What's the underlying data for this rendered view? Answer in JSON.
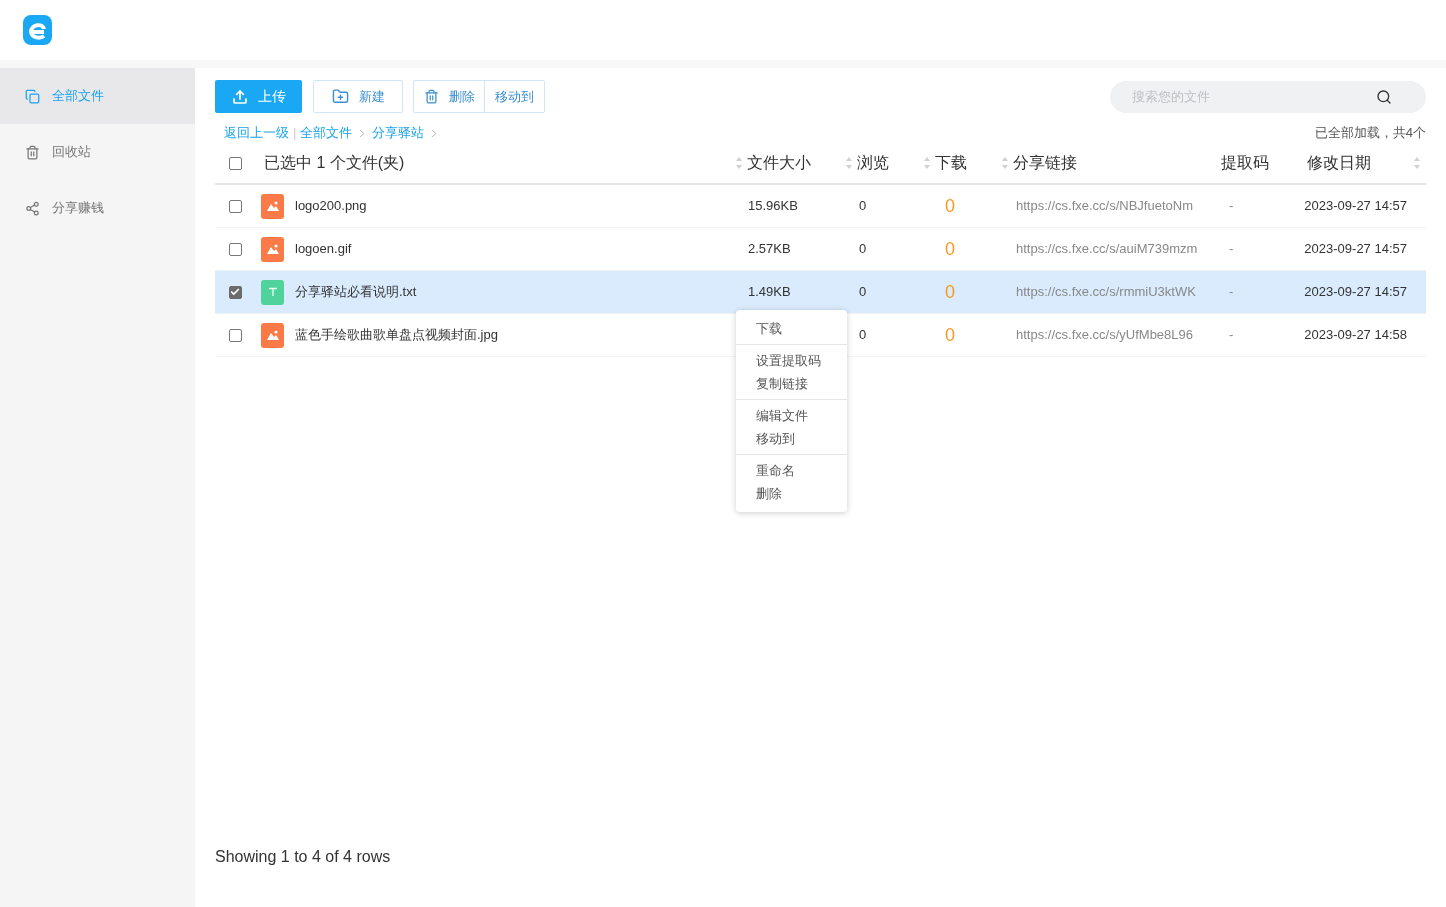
{
  "sidebar": {
    "items": [
      {
        "label": "全部文件",
        "selected": true
      },
      {
        "label": "回收站",
        "selected": false
      },
      {
        "label": "分享赚钱",
        "selected": false
      }
    ]
  },
  "toolbar": {
    "upload": "上传",
    "new": "新建",
    "delete": "删除",
    "move": "移动到"
  },
  "search": {
    "placeholder": "搜索您的文件"
  },
  "breadcrumb": {
    "back": "返回上一级",
    "separator": "|",
    "items": [
      "全部文件",
      "分享驿站"
    ]
  },
  "load_status": "已全部加载，共4个",
  "table": {
    "select_all_checked": false,
    "columns": [
      {
        "label": "已选中 1 个文件(夹)",
        "sortable": true
      },
      {
        "label": "文件大小",
        "sortable": true
      },
      {
        "label": "浏览",
        "sortable": true
      },
      {
        "label": "下载",
        "sortable": true
      },
      {
        "label": "分享链接",
        "sortable": false
      },
      {
        "label": "提取码",
        "sortable": false
      },
      {
        "label": "修改日期",
        "sortable": true
      }
    ],
    "rows": [
      {
        "checked": false,
        "kind": "image",
        "name": "logo200.png",
        "size": "15.96KB",
        "views": "0",
        "downloads": "0",
        "link": "https://cs.fxe.cc/s/NBJfuetoNm",
        "code": "-",
        "date": "2023-09-27 14:57"
      },
      {
        "checked": false,
        "kind": "image",
        "name": "logoen.gif",
        "size": "2.57KB",
        "views": "0",
        "downloads": "0",
        "link": "https://cs.fxe.cc/s/auiM739mzm",
        "code": "-",
        "date": "2023-09-27 14:57"
      },
      {
        "checked": true,
        "kind": "text",
        "name": "分享驿站必看说明.txt",
        "size": "1.49KB",
        "views": "0",
        "downloads": "0",
        "link": "https://cs.fxe.cc/s/rmmiU3ktWK",
        "code": "-",
        "date": "2023-09-27 14:57"
      },
      {
        "checked": false,
        "kind": "image",
        "name": "蓝色手绘歌曲歌单盘点视频封面.jpg",
        "views": "0",
        "downloads": "0",
        "link": "https://cs.fxe.cc/s/yUfMbe8L96",
        "code": "-",
        "date": "2023-09-27 14:58"
      }
    ]
  },
  "context_menu": {
    "groups": [
      [
        "下载"
      ],
      [
        "设置提取码",
        "复制链接"
      ],
      [
        "编辑文件",
        "移动到"
      ],
      [
        "重命名",
        "删除"
      ]
    ]
  },
  "footer": "Showing 1 to 4 of 4 rows"
}
